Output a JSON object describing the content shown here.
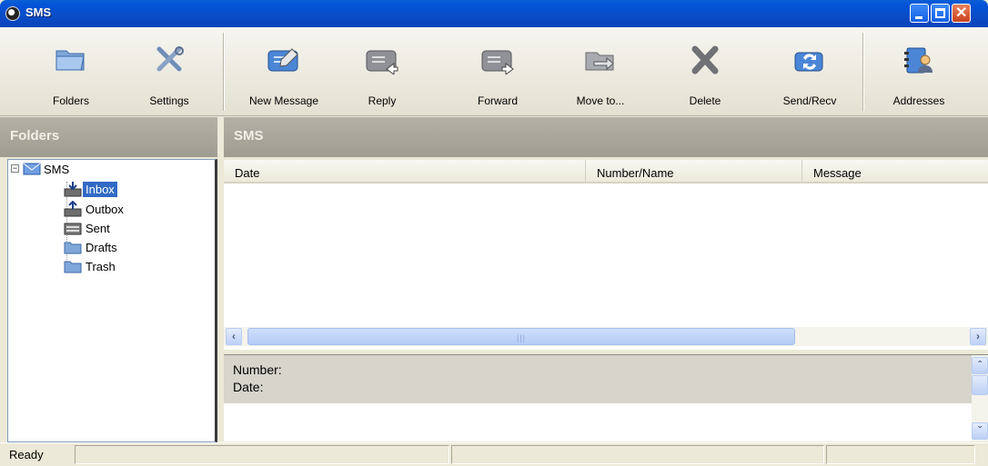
{
  "window": {
    "title": "SMS"
  },
  "toolbar": {
    "items": [
      {
        "label": "Folders",
        "icon": "folders-icon"
      },
      {
        "label": "Settings",
        "icon": "settings-icon"
      },
      {
        "label": "New Message",
        "icon": "new-message-icon"
      },
      {
        "label": "Reply",
        "icon": "reply-icon"
      },
      {
        "label": "Forward",
        "icon": "forward-icon"
      },
      {
        "label": "Move to...",
        "icon": "move-to-icon"
      },
      {
        "label": "Delete",
        "icon": "delete-icon"
      },
      {
        "label": "Send/Recv",
        "icon": "send-recv-icon"
      },
      {
        "label": "Addresses",
        "icon": "addresses-icon"
      }
    ]
  },
  "left_panel": {
    "title": "Folders"
  },
  "right_panel": {
    "title": "SMS"
  },
  "tree": {
    "root": "SMS",
    "folders": [
      "Inbox",
      "Outbox",
      "Sent",
      "Drafts",
      "Trash"
    ],
    "selected": "Inbox"
  },
  "list": {
    "columns": [
      "Date",
      "Number/Name",
      "Message"
    ],
    "rows": []
  },
  "preview": {
    "number_label": "Number:",
    "date_label": "Date:"
  },
  "status": {
    "text": "Ready"
  },
  "colors": {
    "title_bar": "#0a53d0",
    "selection": "#316ac5",
    "header_gray": "#a9a79b"
  }
}
